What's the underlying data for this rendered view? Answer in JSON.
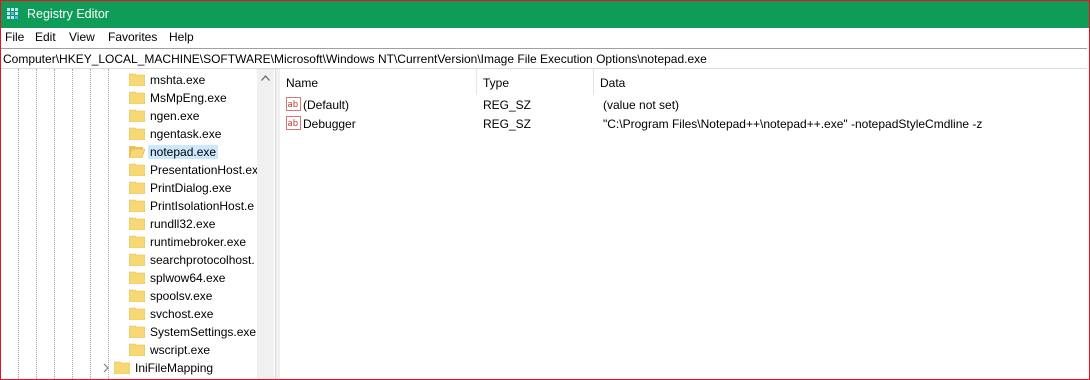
{
  "window": {
    "title": "Registry Editor"
  },
  "menu": [
    "File",
    "Edit",
    "View",
    "Favorites",
    "Help"
  ],
  "address": "Computer\\HKEY_LOCAL_MACHINE\\SOFTWARE\\Microsoft\\Windows NT\\CurrentVersion\\Image File Execution Options\\notepad.exe",
  "tree": {
    "items": [
      "mshta.exe",
      "MsMpEng.exe",
      "ngen.exe",
      "ngentask.exe",
      "notepad.exe",
      "PresentationHost.ex",
      "PrintDialog.exe",
      "PrintIsolationHost.e",
      "rundll32.exe",
      "runtimebroker.exe",
      "searchprotocolhost.",
      "splwow64.exe",
      "spoolsv.exe",
      "svchost.exe",
      "SystemSettings.exe",
      "wscript.exe"
    ],
    "selected": "notepad.exe",
    "parent_sibling": "IniFileMapping"
  },
  "list": {
    "columns": [
      "Name",
      "Type",
      "Data"
    ],
    "rows": [
      {
        "name": "(Default)",
        "type": "REG_SZ",
        "data": "(value not set)",
        "icon": "string-value-icon"
      },
      {
        "name": "Debugger",
        "type": "REG_SZ",
        "data": "\"C:\\Program Files\\Notepad++\\notepad++.exe\" -notepadStyleCmdline -z",
        "icon": "string-value-icon"
      }
    ]
  },
  "colors": {
    "titlebar": "#0f9b58",
    "border": "#e81123",
    "selection": "#cce8ff"
  }
}
